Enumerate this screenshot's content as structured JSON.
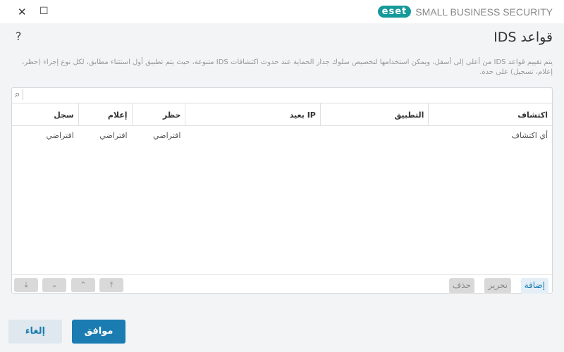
{
  "window": {
    "close": "✕",
    "maximize": "☐"
  },
  "brand": {
    "logo": "eset",
    "product": "SMALL BUSINESS SECURITY"
  },
  "help": "?",
  "title": "قواعد IDS",
  "description": "يتم تقييم قواعد IDS من أعلى إلى أسفل، ويمكن استخدامها لتخصيص سلوك جدار الحماية عند حدوث اكتشافات IDS متنوعة، حيث يتم تطبيق أول استثناء مطابق، لكل نوع إجراء (حظر، إعلام، تسجيل) على حدة.",
  "search": {
    "placeholder": ""
  },
  "columns": [
    "اكتشاف",
    "التطبيق",
    "IP بعيد",
    "حظر",
    "إعلام",
    "سجل"
  ],
  "rows": [
    [
      "أي اكتشاف",
      "",
      "",
      "افتراضي",
      "افتراضي",
      "افتراضي"
    ]
  ],
  "actions": {
    "add": "إضافة",
    "edit": "تحرير",
    "delete": "حذف"
  },
  "buttons": {
    "ok": "موافق",
    "cancel": "إلغاء"
  },
  "colors": {
    "accent": "#1a7cb1",
    "brand": "#16999a"
  }
}
